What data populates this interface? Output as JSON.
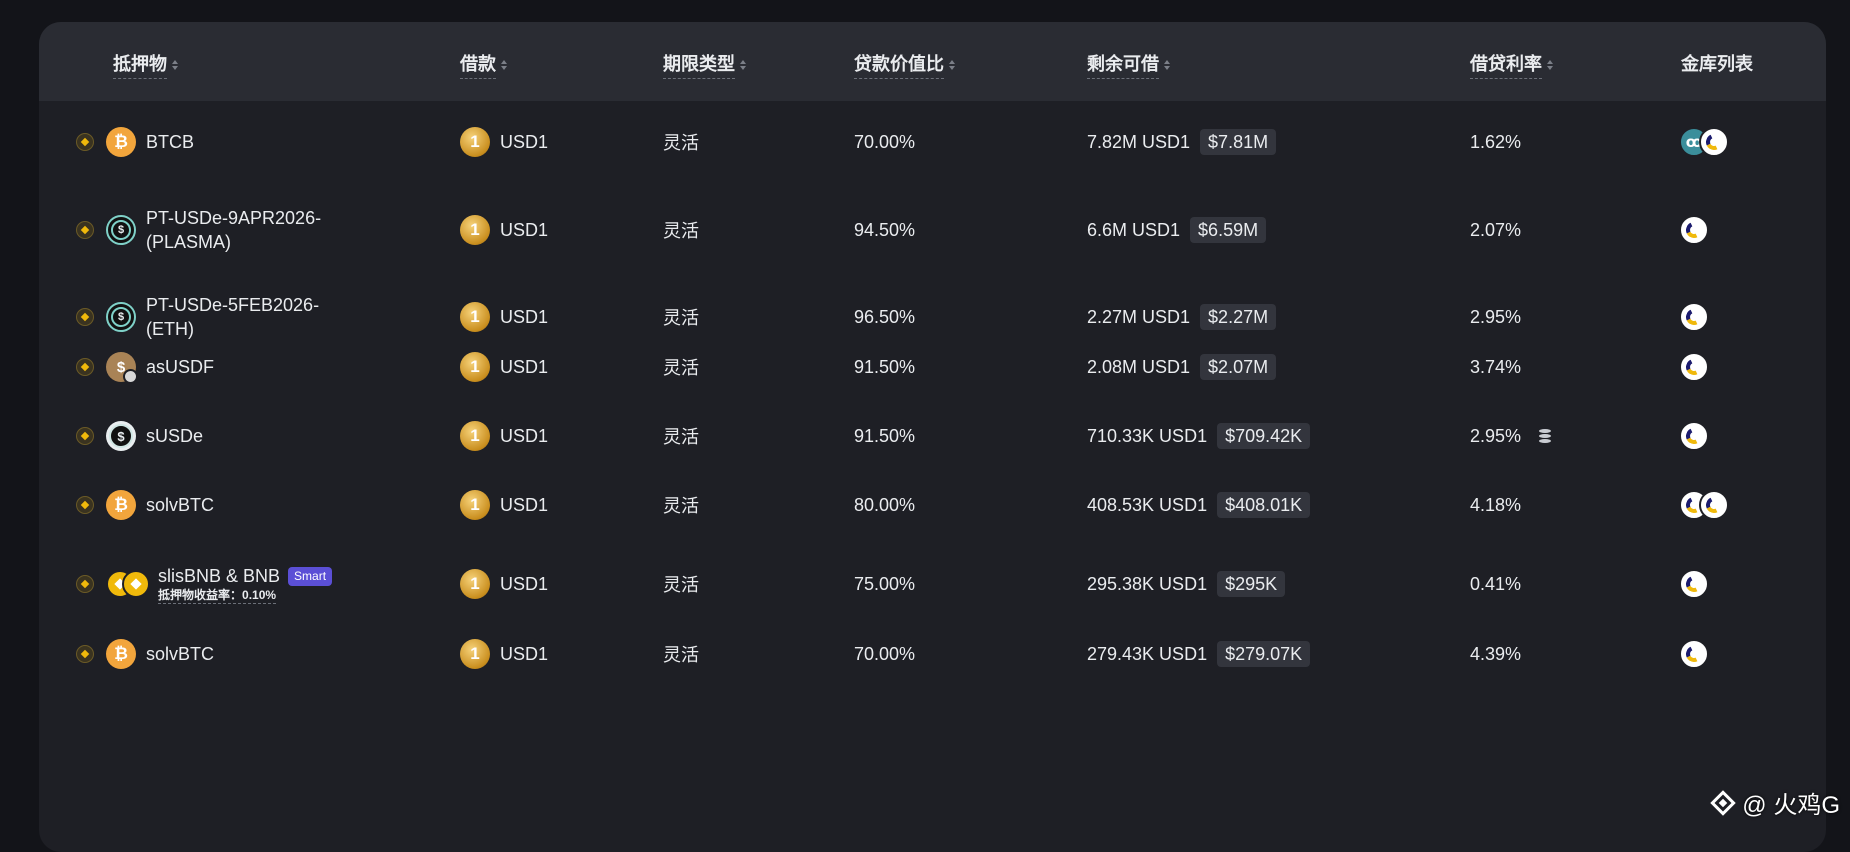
{
  "header": {
    "collateral": "抵押物",
    "borrow": "借款",
    "term_type": "期限类型",
    "ltv": "贷款价值比",
    "remaining": "剩余可借",
    "rate": "借贷利率",
    "vaults": "金库列表"
  },
  "rows": [
    {
      "collateral": "BTCB",
      "collateral_icon": "btc-coin-icon",
      "borrow": "USD1",
      "term": "灵活",
      "ltv": "70.00%",
      "remaining": "7.82M USD1",
      "remaining_usd": "$7.81M",
      "rate": "1.62%",
      "vaults": [
        "teal-vault-icon",
        "lista-vault-icon"
      ]
    },
    {
      "collateral": "PT-USDe-9APR2026-(PLASMA)",
      "collateral_line1": "PT-USDe-9APR2026-",
      "collateral_line2": "(PLASMA)",
      "collateral_icon": "pt-usde-icon",
      "borrow": "USD1",
      "term": "灵活",
      "ltv": "94.50%",
      "remaining": "6.6M USD1",
      "remaining_usd": "$6.59M",
      "rate": "2.07%",
      "vaults": [
        "lista-vault-icon"
      ]
    },
    {
      "collateral": "PT-USDe-5FEB2026-(ETH)",
      "collateral_line1": "PT-USDe-5FEB2026-",
      "collateral_line2": "(ETH)",
      "collateral_icon": "pt-usde-icon",
      "borrow": "USD1",
      "term": "灵活",
      "ltv": "96.50%",
      "remaining": "2.27M USD1",
      "remaining_usd": "$2.27M",
      "rate": "2.95%",
      "vaults": [
        "lista-vault-icon"
      ]
    },
    {
      "collateral": "asUSDF",
      "collateral_icon": "asusdf-coin-icon",
      "borrow": "USD1",
      "term": "灵活",
      "ltv": "91.50%",
      "remaining": "2.08M USD1",
      "remaining_usd": "$2.07M",
      "rate": "3.74%",
      "vaults": [
        "lista-vault-icon"
      ]
    },
    {
      "collateral": "sUSDe",
      "collateral_icon": "susde-coin-icon",
      "borrow": "USD1",
      "term": "灵活",
      "ltv": "91.50%",
      "remaining": "710.33K USD1",
      "remaining_usd": "$709.42K",
      "rate": "2.95%",
      "rate_icon": "database-icon",
      "vaults": [
        "lista-vault-icon"
      ]
    },
    {
      "collateral": "solvBTC",
      "collateral_icon": "btc-coin-icon",
      "borrow": "USD1",
      "term": "灵活",
      "ltv": "80.00%",
      "remaining": "408.53K USD1",
      "remaining_usd": "$408.01K",
      "rate": "4.18%",
      "vaults": [
        "lista-vault-icon",
        "lista-vault-icon"
      ]
    },
    {
      "collateral": "slisBNB & BNB",
      "collateral_icon": "slisbnb-bnb-icon",
      "badge": "Smart",
      "yield_label": "抵押物收益率：",
      "yield_value": "0.10%",
      "borrow": "USD1",
      "term": "灵活",
      "ltv": "75.00%",
      "remaining": "295.38K USD1",
      "remaining_usd": "$295K",
      "rate": "0.41%",
      "vaults": [
        "lista-vault-icon"
      ]
    },
    {
      "collateral": "solvBTC",
      "collateral_icon": "btc-coin-icon",
      "borrow": "USD1",
      "term": "灵活",
      "ltv": "70.00%",
      "remaining": "279.43K USD1",
      "remaining_usd": "$279.07K",
      "rate": "4.39%",
      "vaults": [
        "lista-vault-icon"
      ]
    }
  ],
  "watermark": "@ 火鸡G",
  "colors": {
    "background": "#131419",
    "panel": "#1e1f25",
    "header": "#2a2c33",
    "smart_badge": "#5b4fd6",
    "coin_gold": "#f0b90b"
  }
}
